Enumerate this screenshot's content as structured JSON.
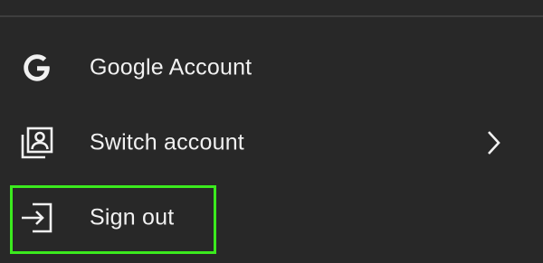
{
  "menu": {
    "items": [
      {
        "label": "Google Account",
        "icon": "google-g-icon"
      },
      {
        "label": "Switch account",
        "icon": "switch-account-icon",
        "submenu_icon": "chevron-right-icon"
      },
      {
        "label": "Sign out",
        "icon": "sign-out-icon",
        "highlighted": true
      }
    ]
  },
  "colors": {
    "background": "#282828",
    "text": "#f1f1f1",
    "divider": "#3e3e3e",
    "highlight_border": "#3bea1e"
  }
}
